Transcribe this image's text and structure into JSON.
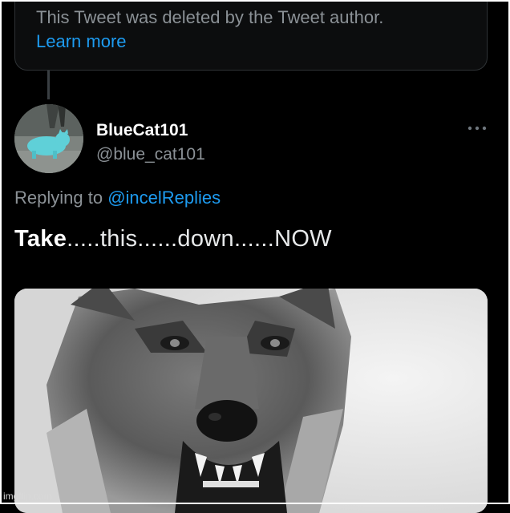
{
  "deleted_notice": {
    "text": "This Tweet was deleted by the Tweet author.",
    "link_label": "Learn more"
  },
  "reply": {
    "display_name": "BlueCat101",
    "handle": "@blue_cat101",
    "replying_prefix": "Replying to",
    "replying_mention": "@incelReplies",
    "text_bold": "Take",
    "text_rest": ".....this......down......NOW",
    "more_icon": "more-horizontal-icon"
  },
  "watermark": "imgflip.com",
  "colors": {
    "background": "#000000",
    "accent": "#1d9bf0",
    "muted": "#8b9196"
  }
}
